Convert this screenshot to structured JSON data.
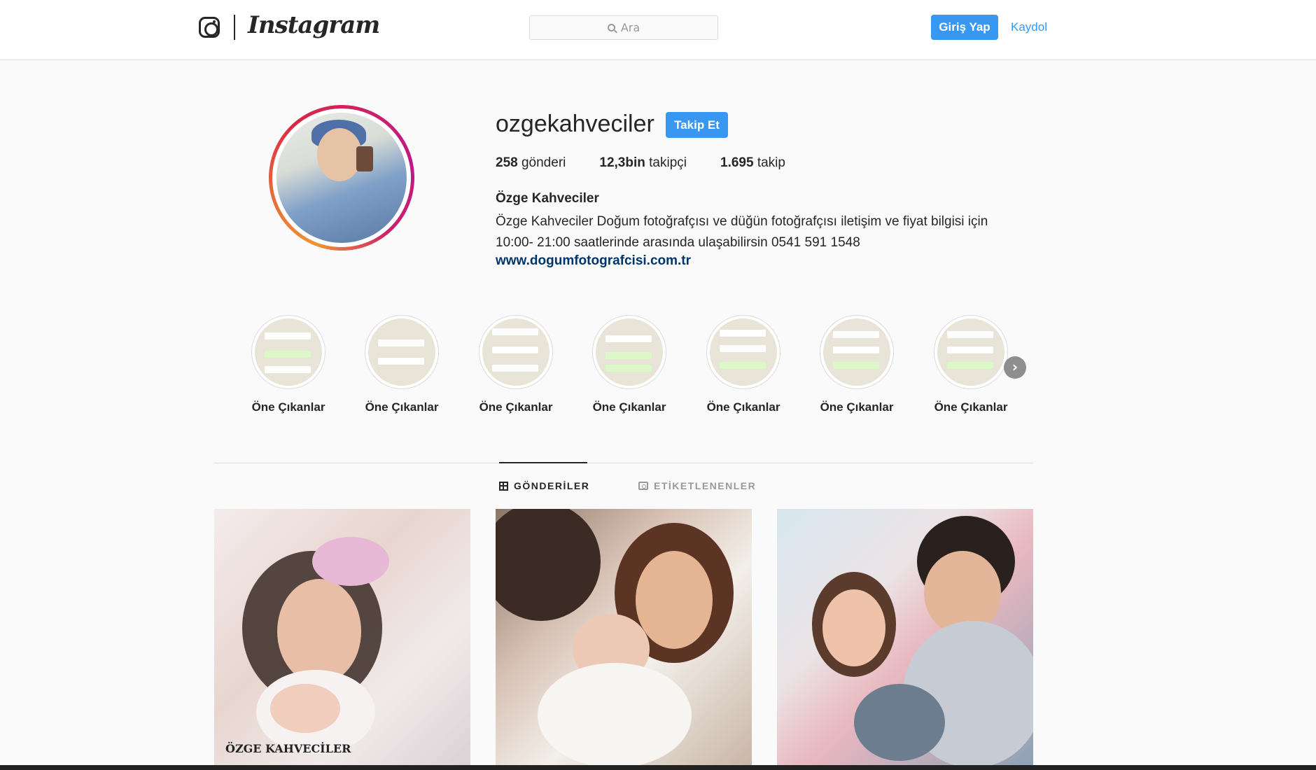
{
  "header": {
    "wordmark": "Instagram",
    "search_placeholder": "Ara",
    "login_label": "Giriş Yap",
    "signup_label": "Kaydol"
  },
  "profile": {
    "username": "ozgekahveciler",
    "follow_label": "Takip Et",
    "stats": [
      {
        "value": "258",
        "label": "gönderi"
      },
      {
        "value": "12,3bin",
        "label": "takipçi"
      },
      {
        "value": "1.695",
        "label": "takip"
      }
    ],
    "full_name": "Özge Kahveciler",
    "bio_line1": "Özge Kahveciler Doğum fotoğrafçısı ve düğün fotoğrafçısı iletişim ve fiyat bilgisi için",
    "bio_line2": "10:00- 21:00 saatlerinde arasında ulaşabilirsin 0541 591 1548",
    "website": "www.dogumfotografcisi.com.tr"
  },
  "highlights": [
    {
      "label": "Öne Çıkanlar"
    },
    {
      "label": "Öne Çıkanlar"
    },
    {
      "label": "Öne Çıkanlar"
    },
    {
      "label": "Öne Çıkanlar"
    },
    {
      "label": "Öne Çıkanlar"
    },
    {
      "label": "Öne Çıkanlar"
    },
    {
      "label": "Öne Çıkanlar"
    }
  ],
  "tabs": {
    "posts": "GÖNDERİLER",
    "tagged": "ETİKETLENENLER"
  },
  "posts": [
    {
      "watermark": "ÖZGE KAHVECİLER"
    },
    {
      "watermark": ""
    },
    {
      "watermark": ""
    }
  ],
  "colors": {
    "accent": "#3897f0",
    "link": "#003569",
    "background": "#fafafa",
    "border": "#dbdbdb"
  }
}
